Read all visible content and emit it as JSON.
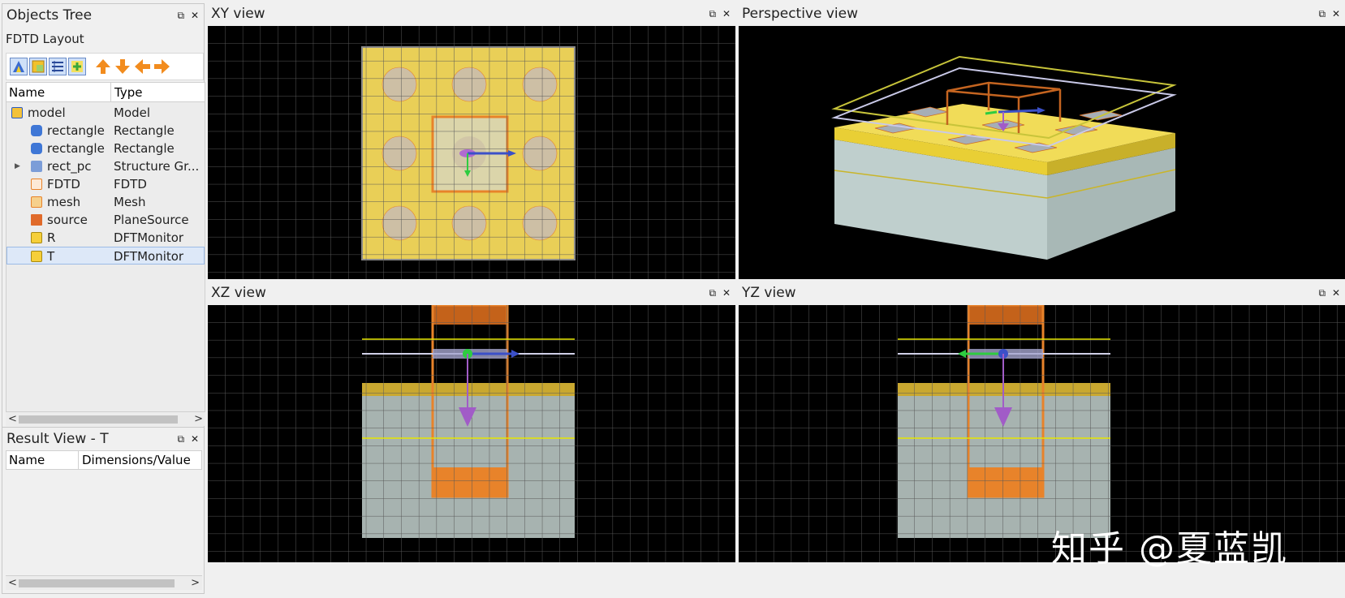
{
  "objects_tree": {
    "title": "Objects Tree",
    "layout_label": "FDTD Layout",
    "columns": {
      "name": "Name",
      "type": "Type"
    },
    "rows": [
      {
        "name": "model",
        "type": "Model",
        "icon": "model-icon"
      },
      {
        "name": "rectangle",
        "type": "Rectangle",
        "icon": "rectangle-icon"
      },
      {
        "name": "rectangle",
        "type": "Rectangle",
        "icon": "rectangle-icon"
      },
      {
        "name": "rect_pc",
        "type": "Structure Gr...",
        "icon": "structure-group-icon"
      },
      {
        "name": "FDTD",
        "type": "FDTD",
        "icon": "fdtd-icon"
      },
      {
        "name": "mesh",
        "type": "Mesh",
        "icon": "mesh-icon"
      },
      {
        "name": "source",
        "type": "PlaneSource",
        "icon": "source-icon"
      },
      {
        "name": "R",
        "type": "DFTMonitor",
        "icon": "monitor-icon"
      },
      {
        "name": "T",
        "type": "DFTMonitor",
        "icon": "monitor-icon"
      }
    ]
  },
  "result_view": {
    "title": "Result View - T",
    "columns": {
      "name": "Name",
      "value": "Dimensions/Value"
    }
  },
  "views": {
    "xy": "XY view",
    "perspective": "Perspective view",
    "xz": "XZ view",
    "yz": "YZ view"
  },
  "window_buttons": {
    "restore": "⧉",
    "close": "✕"
  },
  "colors": {
    "substrate_top": "#e8cf55",
    "substrate": "#a7b3b0",
    "gold": "#c9a830",
    "orange": "#e8832a",
    "grid": "#555555",
    "purple": "#a15cc7",
    "green": "#2ecc40",
    "blue": "#3b50c8"
  },
  "watermark": "知乎 @夏蓝凯"
}
